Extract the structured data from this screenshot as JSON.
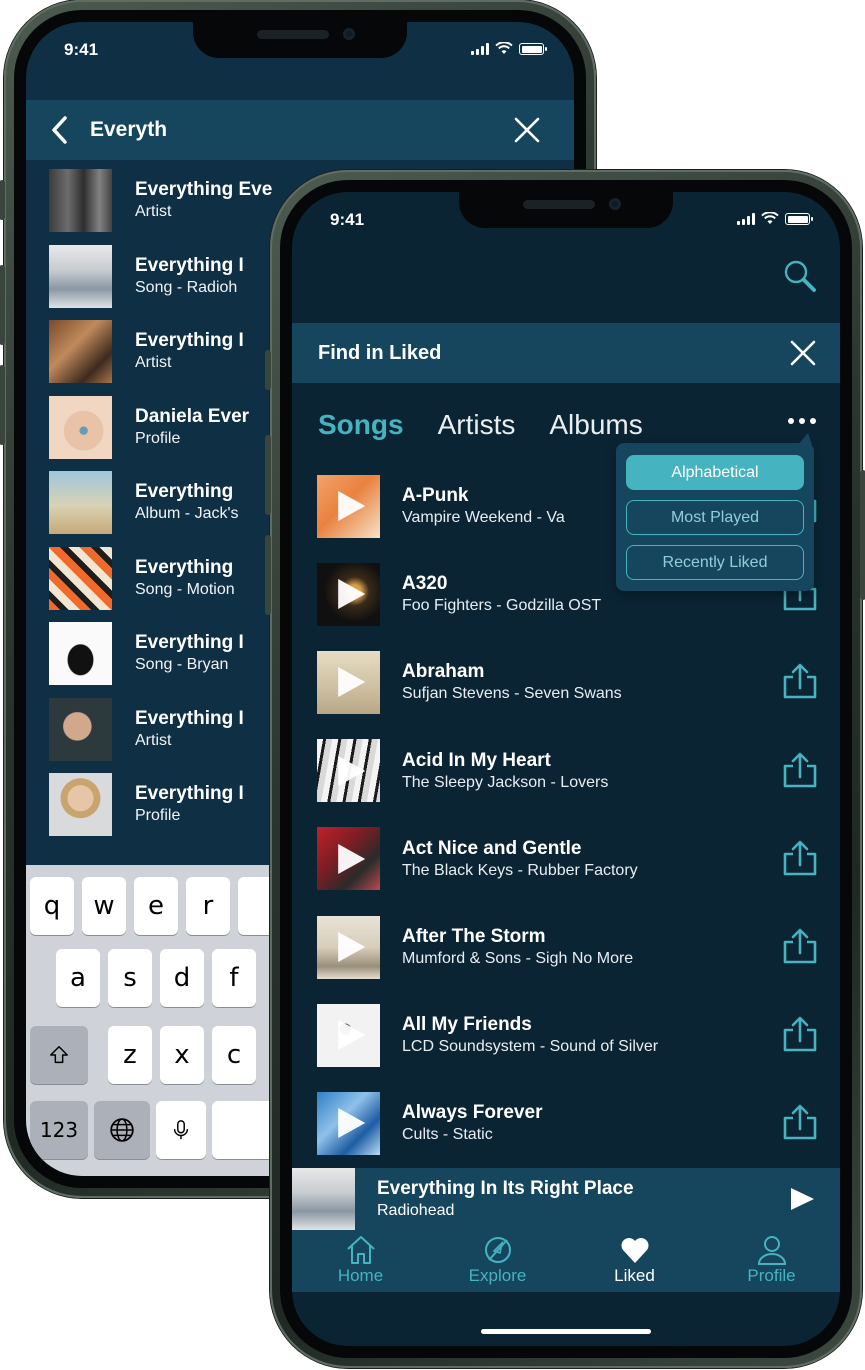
{
  "colors": {
    "accent": "#45b3c0",
    "background": "#0b2433",
    "header": "#16465e"
  },
  "back_phone": {
    "status": {
      "time": "9:41"
    },
    "search": {
      "query": "Everyth"
    },
    "results": [
      {
        "title": "Everything Eve",
        "subtitle": "Artist"
      },
      {
        "title": "Everything I",
        "subtitle": "Song - Radioh"
      },
      {
        "title": "Everything I",
        "subtitle": "Artist"
      },
      {
        "title": "Daniela Ever",
        "subtitle": "Profile"
      },
      {
        "title": "Everything",
        "subtitle": "Album - Jack's"
      },
      {
        "title": "Everything",
        "subtitle": "Song - Motion"
      },
      {
        "title": "Everything I",
        "subtitle": "Song - Bryan"
      },
      {
        "title": "Everything I",
        "subtitle": "Artist"
      },
      {
        "title": "Everything I",
        "subtitle": "Profile"
      }
    ],
    "keyboard": {
      "row1": [
        "q",
        "w",
        "e",
        "r"
      ],
      "row2": [
        "a",
        "s",
        "d",
        "f"
      ],
      "row3": [
        "z",
        "x",
        "c"
      ],
      "numbers_key": "123"
    }
  },
  "front_phone": {
    "status": {
      "time": "9:41"
    },
    "find_bar": {
      "title": "Find in Liked"
    },
    "tabs": [
      {
        "label": "Songs",
        "active": true
      },
      {
        "label": "Artists",
        "active": false
      },
      {
        "label": "Albums",
        "active": false
      }
    ],
    "sort_menu": {
      "options": [
        {
          "label": "Alphabetical",
          "selected": true
        },
        {
          "label": "Most Played",
          "selected": false
        },
        {
          "label": "Recently Liked",
          "selected": false
        }
      ]
    },
    "songs": [
      {
        "title": "A-Punk",
        "subtitle": "Vampire Weekend - Va"
      },
      {
        "title": "A320",
        "subtitle": "Foo Fighters - Godzilla OST"
      },
      {
        "title": "Abraham",
        "subtitle": "Sufjan Stevens - Seven Swans"
      },
      {
        "title": "Acid In My Heart",
        "subtitle": "The Sleepy Jackson - Lovers"
      },
      {
        "title": "Act Nice and Gentle",
        "subtitle": "The Black Keys - Rubber Factory"
      },
      {
        "title": "After The Storm",
        "subtitle": "Mumford & Sons - Sigh No More"
      },
      {
        "title": "All My Friends",
        "subtitle": "LCD Soundsystem - Sound of Silver"
      },
      {
        "title": "Always Forever",
        "subtitle": "Cults - Static"
      }
    ],
    "now_playing": {
      "title": "Everything In Its Right Place",
      "artist": "Radiohead"
    },
    "tabbar": [
      {
        "label": "Home",
        "icon": "home-icon",
        "active": false
      },
      {
        "label": "Explore",
        "icon": "compass-icon",
        "active": false
      },
      {
        "label": "Liked",
        "icon": "heart-icon",
        "active": true
      },
      {
        "label": "Profile",
        "icon": "person-icon",
        "active": false
      }
    ]
  }
}
